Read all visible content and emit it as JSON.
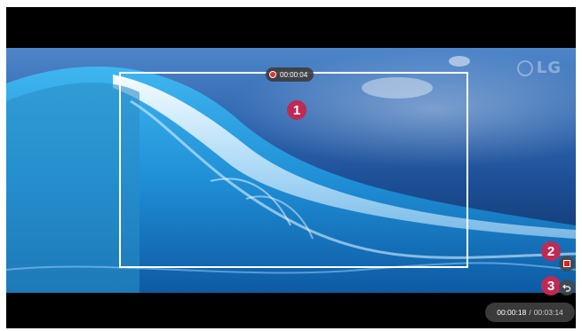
{
  "recording": {
    "elapsed": "00:00:04",
    "marker": "1"
  },
  "watermark": "LG",
  "controls": {
    "stop_marker": "2",
    "back_marker": "3",
    "stop_icon": "stop-icon",
    "back_icon": "back-arrow-icon"
  },
  "playback": {
    "current": "00:00:18",
    "separator": "/",
    "total": "00:03:14"
  },
  "colors": {
    "marker": "#c02a52",
    "record": "#e53030",
    "frame": "#ffffff"
  }
}
